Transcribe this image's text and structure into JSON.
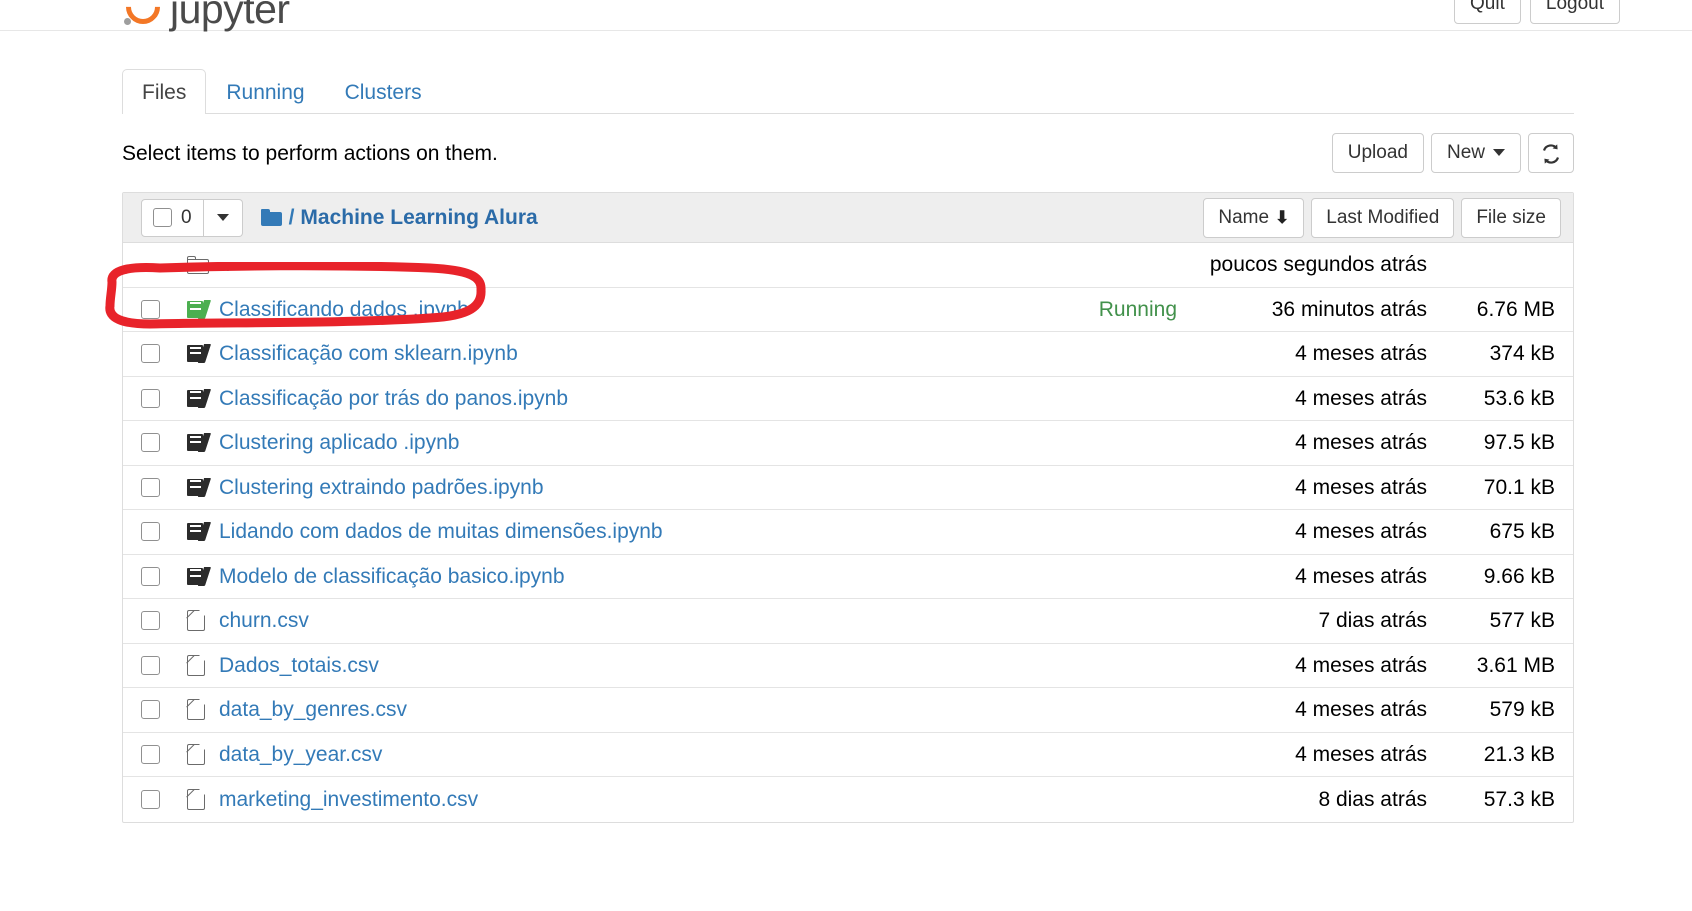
{
  "brand": {
    "name": "jupyter",
    "logo_icon": "jupyter-logo-icon"
  },
  "header": {
    "quit_label": "Quit",
    "logout_label": "Logout"
  },
  "tabs": [
    {
      "label": "Files",
      "active": true
    },
    {
      "label": "Running",
      "active": false
    },
    {
      "label": "Clusters",
      "active": false
    }
  ],
  "toolbar": {
    "hint": "Select items to perform actions on them.",
    "upload_label": "Upload",
    "new_label": "New",
    "new_caret_icon": "chevron-down-icon",
    "refresh_icon": "refresh-icon"
  },
  "filelist": {
    "select_all_count": "0",
    "select_all_caret_icon": "chevron-down-icon",
    "folder_icon": "folder-icon",
    "breadcrumb_separator": "/",
    "breadcrumb_path": "Machine Learning Alura",
    "sort": {
      "name_label": "Name",
      "name_arrow_icon": "arrow-down-icon",
      "name_arrow": "↓",
      "last_modified_label": "Last Modified",
      "file_size_label": "File size"
    },
    "columns": [
      "Name",
      "Last Modified",
      "File size"
    ],
    "rows": [
      {
        "icon": "folder-outline-icon",
        "name": "..",
        "running": "",
        "modified": "poucos segundos atrás",
        "size": "",
        "has_checkbox": false,
        "type": "parent-directory"
      },
      {
        "icon": "notebook-running-icon",
        "name": "Classificando dados .ipynb",
        "running": "Running",
        "modified": "36 minutos atrás",
        "size": "6.76 MB",
        "has_checkbox": true,
        "type": "notebook",
        "annotated": true
      },
      {
        "icon": "notebook-icon",
        "name": "Classificação com sklearn.ipynb",
        "running": "",
        "modified": "4 meses atrás",
        "size": "374 kB",
        "has_checkbox": true,
        "type": "notebook"
      },
      {
        "icon": "notebook-icon",
        "name": "Classificação por trás do panos.ipynb",
        "running": "",
        "modified": "4 meses atrás",
        "size": "53.6 kB",
        "has_checkbox": true,
        "type": "notebook"
      },
      {
        "icon": "notebook-icon",
        "name": "Clustering aplicado .ipynb",
        "running": "",
        "modified": "4 meses atrás",
        "size": "97.5 kB",
        "has_checkbox": true,
        "type": "notebook"
      },
      {
        "icon": "notebook-icon",
        "name": "Clustering extraindo padrões.ipynb",
        "running": "",
        "modified": "4 meses atrás",
        "size": "70.1 kB",
        "has_checkbox": true,
        "type": "notebook"
      },
      {
        "icon": "notebook-icon",
        "name": "Lidando com dados de muitas dimensões.ipynb",
        "running": "",
        "modified": "4 meses atrás",
        "size": "675 kB",
        "has_checkbox": true,
        "type": "notebook"
      },
      {
        "icon": "notebook-icon",
        "name": "Modelo de classificação basico.ipynb",
        "running": "",
        "modified": "4 meses atrás",
        "size": "9.66 kB",
        "has_checkbox": true,
        "type": "notebook"
      },
      {
        "icon": "file-icon",
        "name": "churn.csv",
        "running": "",
        "modified": "7 dias atrás",
        "size": "577 kB",
        "has_checkbox": true,
        "type": "file"
      },
      {
        "icon": "file-icon",
        "name": "Dados_totais.csv",
        "running": "",
        "modified": "4 meses atrás",
        "size": "3.61 MB",
        "has_checkbox": true,
        "type": "file"
      },
      {
        "icon": "file-icon",
        "name": "data_by_genres.csv",
        "running": "",
        "modified": "4 meses atrás",
        "size": "579 kB",
        "has_checkbox": true,
        "type": "file"
      },
      {
        "icon": "file-icon",
        "name": "data_by_year.csv",
        "running": "",
        "modified": "4 meses atrás",
        "size": "21.3 kB",
        "has_checkbox": true,
        "type": "file"
      },
      {
        "icon": "file-icon",
        "name": "marketing_investimento.csv",
        "running": "",
        "modified": "8 dias atrás",
        "size": "57.3 kB",
        "has_checkbox": true,
        "type": "file"
      }
    ]
  },
  "annotation": {
    "shape": "hand-drawn-red-ellipse",
    "color": "#e8232a",
    "targets_row": "Classificando dados .ipynb"
  },
  "colors": {
    "link": "#337ab7",
    "running": "#42914b",
    "brand_orange": "#f37726",
    "annotation_red": "#e8232a",
    "panel_header_bg": "#eeeeee",
    "border": "#dddddd"
  }
}
